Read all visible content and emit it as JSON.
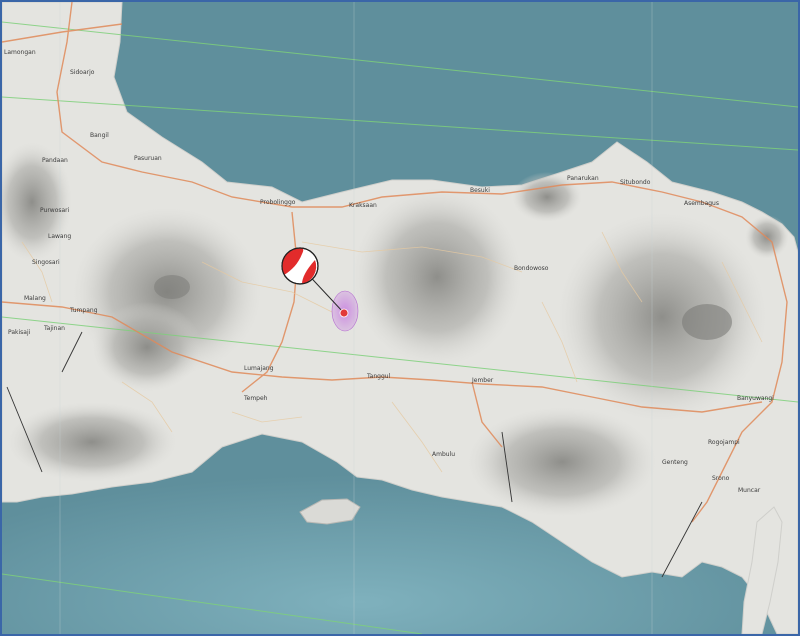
{
  "map": {
    "colors": {
      "sea": "#5f8f9c",
      "sea_light": "#7fb1bd",
      "land": "#e4e4e0",
      "mountain_shade": "#8a8a86",
      "road_major": "#e08a5a",
      "road_minor": "#e6c9a0",
      "boundary_green": "#7ed07a",
      "epicenter": "#e23a3a",
      "intensity_zone": "#c985e0"
    },
    "place_labels": [
      "Sidoarjo",
      "Bangil",
      "Pasuruan",
      "Pandaan",
      "Probolinggo",
      "Kraksaan",
      "Besuki",
      "Panarukan",
      "Situbondo",
      "Asembagus",
      "Bondowoso",
      "Malang",
      "Tumpang",
      "Tajinan",
      "Pakisaji",
      "Singosari",
      "Lawang",
      "Purwosari",
      "Lumajang",
      "Tanggul",
      "Jember",
      "Tempeh",
      "Ambulu",
      "Rogojampi",
      "Genteng",
      "Srono",
      "Muncar",
      "Banyuwangi",
      "Lamongan"
    ],
    "markers": {
      "focal_mechanism": "focal-mechanism-beachball",
      "epicenter": "epicenter-dot"
    }
  }
}
